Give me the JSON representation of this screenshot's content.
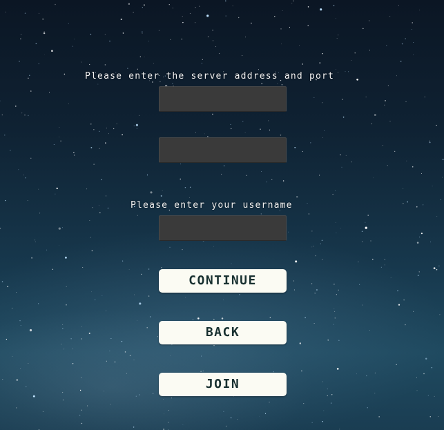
{
  "server_prompt": "Please enter the server address and port",
  "username_prompt": "Please enter your username",
  "fields": {
    "address_value": "",
    "port_value": "",
    "username_value": ""
  },
  "buttons": {
    "continue_label": "CONTINUE",
    "back_label": "BACK",
    "join_label": "JOIN"
  }
}
